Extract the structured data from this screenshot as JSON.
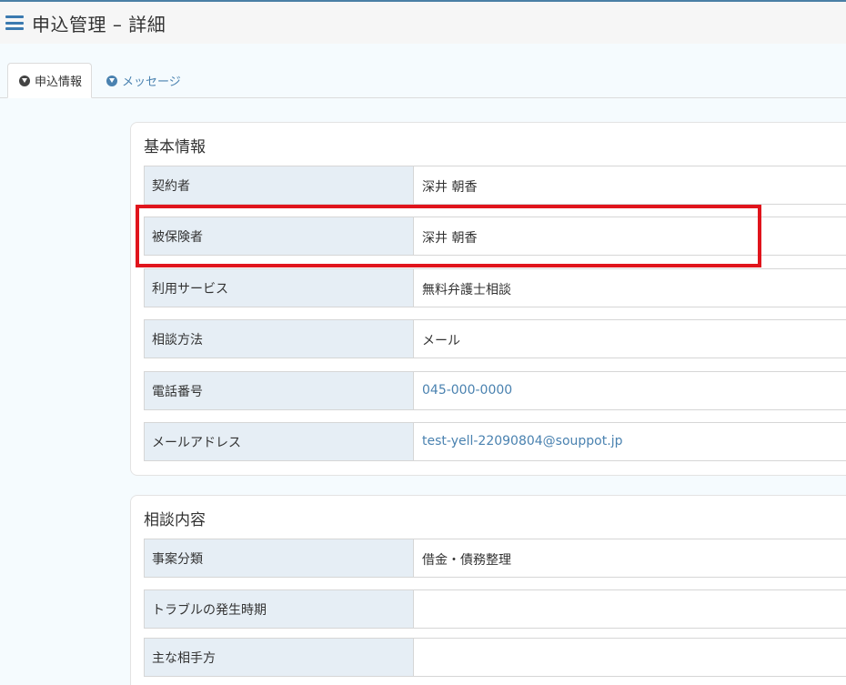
{
  "header": {
    "title": "申込管理 – 詳細",
    "menu_icon": "hamburger-menu-icon"
  },
  "tabs": [
    {
      "label": "申込情報",
      "icon": "circle-arrow-down-icon",
      "active": true
    },
    {
      "label": "メッセージ",
      "icon": "circle-arrow-down-icon",
      "active": false
    }
  ],
  "basic_info": {
    "title": "基本情報",
    "rows": [
      {
        "label": "契約者",
        "value": "深井 朝香"
      },
      {
        "label": "被保険者",
        "value": "深井 朝香"
      },
      {
        "label": "利用サービス",
        "value": "無料弁護士相談"
      },
      {
        "label": "相談方法",
        "value": "メール"
      },
      {
        "label": "電話番号",
        "value": "045-000-0000"
      },
      {
        "label": "メールアドレス",
        "value": "test-yell-22090804@souppot.jp"
      }
    ]
  },
  "consultation": {
    "title": "相談内容",
    "rows": [
      {
        "label": "事案分類",
        "value": "借金・債務整理"
      },
      {
        "label": "トラブルの発生時期",
        "value": ""
      },
      {
        "label": "主な相手方",
        "value": ""
      }
    ]
  },
  "colors": {
    "accent": "#4a82b0",
    "label_bg": "#e6eef5",
    "highlight": "#e0141c"
  }
}
